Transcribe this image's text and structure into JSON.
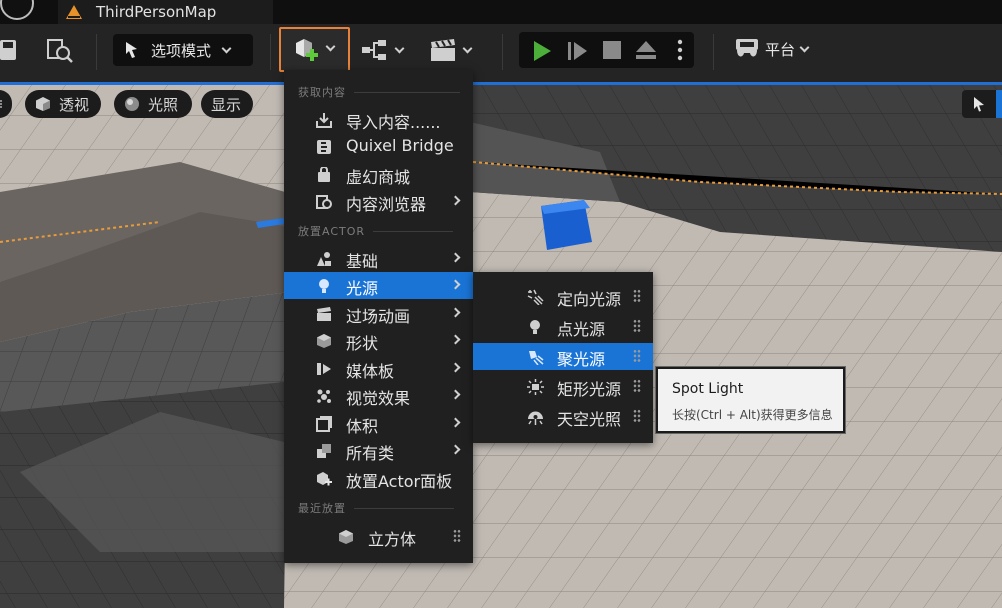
{
  "window": {
    "map_tab": "ThirdPersonMap"
  },
  "toolbar": {
    "mode_label": "选项模式",
    "platform_label": "平台"
  },
  "viewport": {
    "pills": [
      "透视",
      "光照",
      "显示"
    ]
  },
  "add_menu": {
    "section_get": "获取内容",
    "get_items": [
      {
        "label": "导入内容......",
        "icon": "import-icon"
      },
      {
        "label": "Quixel Bridge",
        "icon": "quixel-bridge-icon"
      },
      {
        "label": "虚幻商城",
        "icon": "marketplace-icon"
      },
      {
        "label": "内容浏览器",
        "icon": "content-browser-icon"
      }
    ],
    "section_place": "放置ACTOR",
    "place_items": [
      {
        "label": "基础",
        "icon": "basic-icon"
      },
      {
        "label": "光源",
        "icon": "light-bulb-icon"
      },
      {
        "label": "过场动画",
        "icon": "cinematics-icon"
      },
      {
        "label": "形状",
        "icon": "shapes-icon"
      },
      {
        "label": "媒体板",
        "icon": "media-icon"
      },
      {
        "label": "视觉效果",
        "icon": "visual-effects-icon"
      },
      {
        "label": "体积",
        "icon": "volume-icon"
      },
      {
        "label": "所有类",
        "icon": "all-classes-icon"
      },
      {
        "label": "放置Actor面板",
        "icon": "place-actors-panel-icon"
      }
    ],
    "section_recent": "最近放置",
    "recent_items": [
      {
        "label": "立方体",
        "icon": "cube-icon"
      }
    ]
  },
  "lights_submenu": {
    "items": [
      {
        "label": "定向光源",
        "icon": "directional-light-icon"
      },
      {
        "label": "点光源",
        "icon": "point-light-icon"
      },
      {
        "label": "聚光源",
        "icon": "spot-light-icon"
      },
      {
        "label": "矩形光源",
        "icon": "rect-light-icon"
      },
      {
        "label": "天空光照",
        "icon": "sky-light-icon"
      }
    ]
  },
  "tooltip": {
    "title": "Spot Light",
    "hint": "长按(Ctrl + Alt)获得更多信息"
  },
  "colors": {
    "accent_highlight": "#1a74d6",
    "play_green": "#4caf3a",
    "focus_orange": "#e8823a"
  }
}
